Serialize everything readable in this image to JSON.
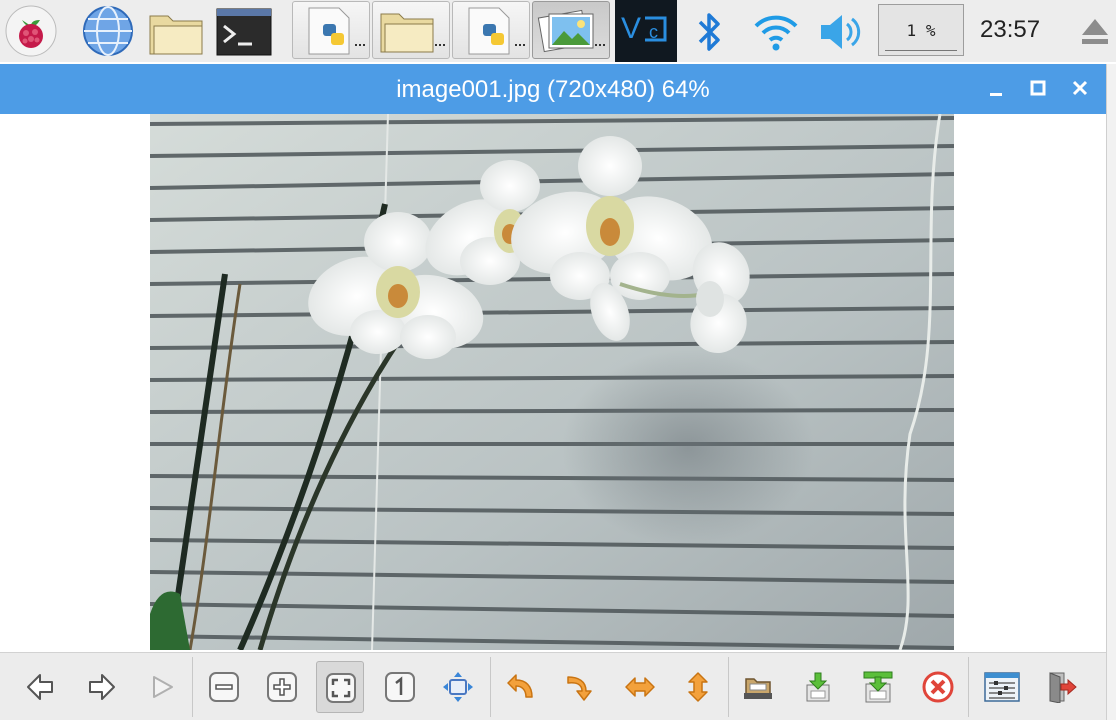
{
  "panel": {
    "launchers": [
      {
        "name": "raspberry-menu-icon"
      },
      {
        "name": "web-browser-icon"
      },
      {
        "name": "file-manager-icon"
      },
      {
        "name": "terminal-icon"
      }
    ],
    "tasks": [
      {
        "name": "python-script-window-1"
      },
      {
        "name": "file-manager-window"
      },
      {
        "name": "python-script-window-2"
      },
      {
        "name": "image-viewer-window",
        "active": true
      }
    ],
    "tray": [
      "vnc-icon",
      "bluetooth-icon",
      "wifi-icon",
      "volume-icon"
    ],
    "cpu_usage": "1 %",
    "clock": "23:57",
    "eject": "eject-icon"
  },
  "window": {
    "title": "image001.jpg (720x480) 64%",
    "controls": [
      "minimize-icon",
      "maximize-icon",
      "close-icon"
    ]
  },
  "toolbar": {
    "buttons": [
      "previous-image-icon",
      "next-image-icon",
      "slideshow-play-icon",
      "zoom-out-icon",
      "zoom-in-icon",
      "fit-to-window-icon",
      "original-size-icon",
      "full-screen-icon",
      "rotate-left-icon",
      "rotate-right-icon",
      "flip-horizontal-icon",
      "flip-vertical-icon",
      "open-file-icon",
      "save-file-icon",
      "save-as-icon",
      "delete-file-icon",
      "preferences-icon",
      "quit-icon"
    ],
    "pressed": "fit-to-window-icon"
  },
  "colors": {
    "titlebar": "#4d9ce6",
    "panel": "#ededed",
    "toolbar_orange": "#f3a13c",
    "toolbar_red": "#e0453a"
  }
}
